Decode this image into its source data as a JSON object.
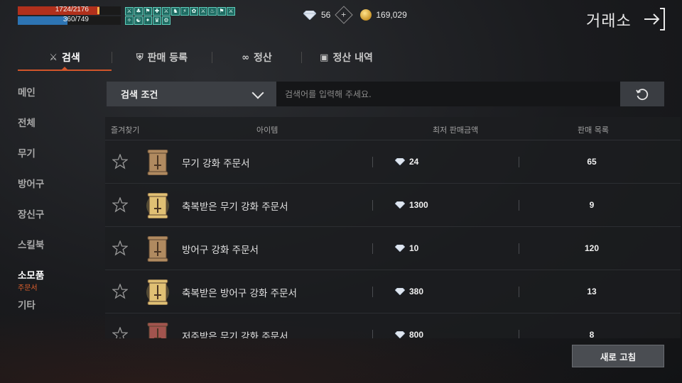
{
  "status": {
    "hp": {
      "current": 1724,
      "max": 2176,
      "label": "1724/2176"
    },
    "mp": {
      "current": 360,
      "max": 749,
      "label": "360/749"
    },
    "buff_icons": [
      "⚔",
      "♣",
      "⚑",
      "✚",
      "⚔",
      "♞",
      "⚡",
      "✿",
      "⚔",
      "♨",
      "⚑",
      "⚔",
      "✧",
      "☯",
      "✦",
      "♛",
      "⚙"
    ]
  },
  "currency": {
    "diamond": "56",
    "gold": "169,029",
    "diamond_icon": "diamond-icon",
    "gold_icon": "gold-coin-icon"
  },
  "header": {
    "title": "거래소",
    "exit_icon": "exit-arrow-icon"
  },
  "tabs": [
    {
      "label": "검색",
      "icon": "sword-icon",
      "active": true
    },
    {
      "label": "판매 등록",
      "icon": "shield-icon",
      "active": false
    },
    {
      "label": "정산",
      "icon": "rings-icon",
      "active": false
    },
    {
      "label": "정산 내역",
      "icon": "box-icon",
      "active": false
    }
  ],
  "sidebar": {
    "items": [
      {
        "label": "메인"
      },
      {
        "label": "전체"
      },
      {
        "label": "무기"
      },
      {
        "label": "방어구"
      },
      {
        "label": "장신구"
      },
      {
        "label": "스킬북"
      },
      {
        "label": "소모품",
        "active": true,
        "sub": "주문서"
      },
      {
        "label": "기타"
      }
    ]
  },
  "search": {
    "filter_label": "검색 조건",
    "placeholder": "검색어를 입력해 주세요."
  },
  "table": {
    "headers": {
      "favorite": "즐겨찾기",
      "item": "아이템",
      "min_price": "최저 판매금액",
      "listings": "판매 목록"
    },
    "rows": [
      {
        "name": "무기 강화 주문서",
        "price": "24",
        "count": "65",
        "icon": "weapon-scroll-icon",
        "tint": "#b08a60",
        "glow": false
      },
      {
        "name": "축복받은 무기 강화 주문서",
        "price": "1300",
        "count": "9",
        "icon": "blessed-weapon-scroll-icon",
        "tint": "#e0c074",
        "glow": true
      },
      {
        "name": "방어구 강화 주문서",
        "price": "10",
        "count": "120",
        "icon": "armor-scroll-icon",
        "tint": "#b08a60",
        "glow": false
      },
      {
        "name": "축복받은 방어구 강화 주문서",
        "price": "380",
        "count": "13",
        "icon": "blessed-armor-scroll-icon",
        "tint": "#e0c074",
        "glow": true
      },
      {
        "name": "저주받은 무기 강화 주문서",
        "price": "800",
        "count": "8",
        "icon": "cursed-weapon-scroll-icon",
        "tint": "#a2544e",
        "glow": false
      }
    ]
  },
  "footer": {
    "refresh_label": "새로 고침"
  }
}
